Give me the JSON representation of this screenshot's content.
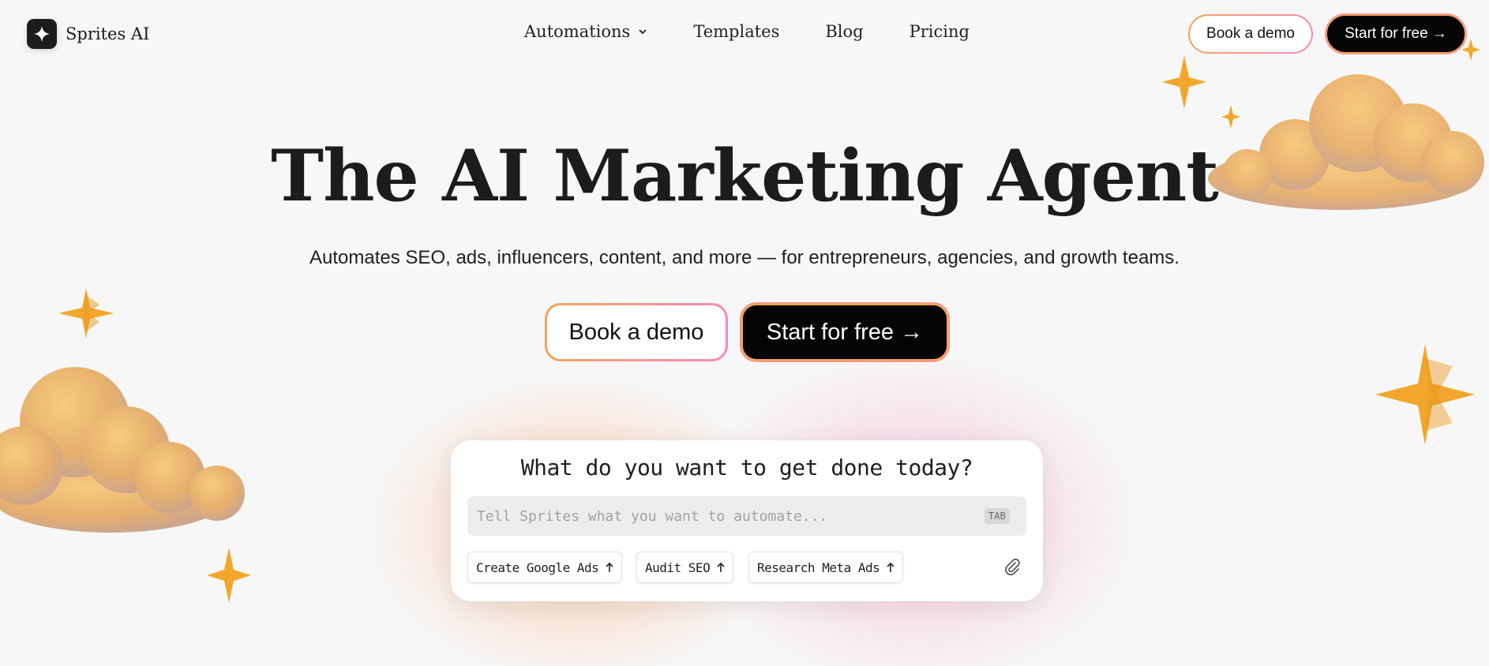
{
  "brand": {
    "name": "Sprites AI"
  },
  "nav": {
    "links": [
      {
        "label": "Automations",
        "has_dropdown": true
      },
      {
        "label": "Templates"
      },
      {
        "label": "Blog"
      },
      {
        "label": "Pricing"
      }
    ],
    "book_demo_label": "Book a demo",
    "start_free_label": "Start for free →"
  },
  "hero": {
    "title": "The AI Marketing Agent",
    "subtitle": "Automates SEO, ads, influencers, content, and more — for entrepreneurs, agencies, and growth teams.",
    "book_demo_label": "Book a demo",
    "start_free_label": "Start for free →"
  },
  "prompt": {
    "title": "What do you want to get done today?",
    "placeholder": "Tell Sprites what you want to automate...",
    "tab_hint": "TAB",
    "chips": [
      {
        "label": "Create Google Ads"
      },
      {
        "label": "Audit SEO"
      },
      {
        "label": "Research Meta Ads"
      }
    ]
  },
  "icons": {
    "brand": "sparkle-logo-icon",
    "dropdown": "chevron-down-icon",
    "chip_arrow": "arrow-up-icon",
    "attach": "paperclip-icon",
    "decor": [
      "cloud-illustration",
      "star-illustration"
    ]
  },
  "colors": {
    "background": "#f7f7f7",
    "accent_orange": "#f7a35c",
    "accent_pink": "#f58bb8",
    "dark_button": "#050505",
    "star_gold": "#f2a72c"
  }
}
